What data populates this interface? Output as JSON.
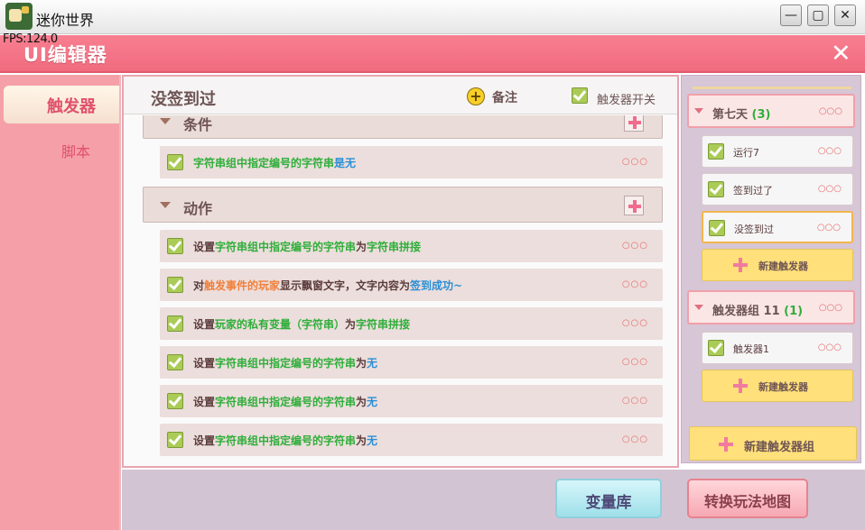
{
  "window": {
    "title": "迷你世界",
    "minimize": "—",
    "maximize": "▢",
    "close": "✕"
  },
  "fps": "FPS:124.0",
  "header": {
    "title": "UI编辑器",
    "close": "✕"
  },
  "left_nav": {
    "tabs": [
      "触发器",
      "脚本"
    ]
  },
  "trigger": {
    "name": "没签到过",
    "note_label": "备注",
    "switch_label": "触发器开关",
    "switch_on": true
  },
  "sections": {
    "condition": {
      "label": "条件",
      "rows": [
        {
          "parts": [
            {
              "t": "字符串组中指定编号的字符串",
              "c": "g"
            },
            {
              "t": "是",
              "c": "b"
            },
            {
              "t": "无",
              "c": "b"
            }
          ]
        }
      ]
    },
    "action": {
      "label": "动作",
      "rows": [
        {
          "parts": [
            {
              "t": "设置",
              "c": ""
            },
            {
              "t": "字符串组中指定编号的字符串",
              "c": "g"
            },
            {
              "t": "为",
              "c": ""
            },
            {
              "t": "字符串拼接",
              "c": "g"
            }
          ]
        },
        {
          "parts": [
            {
              "t": "对",
              "c": ""
            },
            {
              "t": "触发事件的玩家",
              "c": "o"
            },
            {
              "t": "显示飘窗文字，文字内容为",
              "c": ""
            },
            {
              "t": "签到成功~",
              "c": "b"
            }
          ]
        },
        {
          "parts": [
            {
              "t": "设置",
              "c": ""
            },
            {
              "t": "玩家的私有变量（字符串）",
              "c": "g"
            },
            {
              "t": "为",
              "c": ""
            },
            {
              "t": "字符串拼接",
              "c": "g"
            }
          ]
        },
        {
          "parts": [
            {
              "t": "设置",
              "c": ""
            },
            {
              "t": "字符串组中指定编号的字符串",
              "c": "g"
            },
            {
              "t": "为",
              "c": ""
            },
            {
              "t": "无",
              "c": "b"
            }
          ]
        },
        {
          "parts": [
            {
              "t": "设置",
              "c": ""
            },
            {
              "t": "字符串组中指定编号的字符串",
              "c": "g"
            },
            {
              "t": "为",
              "c": ""
            },
            {
              "t": "无",
              "c": "b"
            }
          ]
        },
        {
          "parts": [
            {
              "t": "设置",
              "c": ""
            },
            {
              "t": "字符串组中指定编号的字符串",
              "c": "g"
            },
            {
              "t": "为",
              "c": ""
            },
            {
              "t": "无",
              "c": "b"
            }
          ]
        }
      ]
    }
  },
  "dots": "○○○",
  "right_panel": {
    "groups": [
      {
        "label": "第七天",
        "count": "(3)",
        "items": [
          "运行7",
          "签到过了",
          "没签到过"
        ],
        "selected_index": 2,
        "new_label": "新建触发器"
      },
      {
        "label": "触发器组 11",
        "count": "(1)",
        "items": [
          "触发器1"
        ],
        "selected_index": -1,
        "new_label": "新建触发器"
      }
    ],
    "new_group_label": "新建触发器组"
  },
  "footer": {
    "variable_library": "变量库",
    "convert_map": "转换玩法地图"
  },
  "colors": {
    "accent_pink": "#f16b7f",
    "green_text": "#2fae3a",
    "orange_text": "#f0803c",
    "blue_text": "#2a8fd6",
    "new_button_yellow": "#ffe07a"
  }
}
